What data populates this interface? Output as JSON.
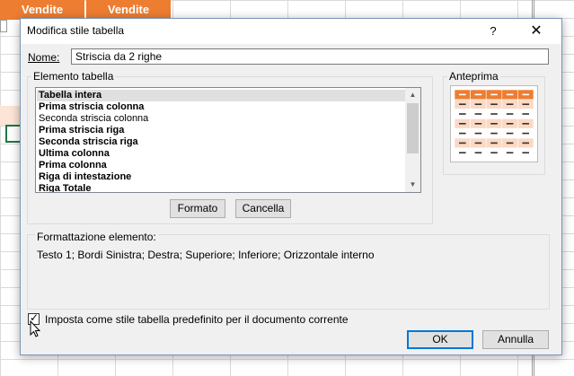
{
  "sheet": {
    "header_cells": [
      "Vendite",
      "Vendite"
    ],
    "accent_color": "#ed7d31"
  },
  "dialog": {
    "title": "Modifica stile tabella",
    "help_label": "?",
    "close_label": "✕",
    "name_label": "Nome:",
    "name_value": "Striscia da 2 righe",
    "element_group_label": "Elemento tabella",
    "elements": [
      {
        "label": "Tabella intera",
        "bold": true,
        "selected": true
      },
      {
        "label": "Prima striscia colonna",
        "bold": true,
        "selected": false
      },
      {
        "label": "Seconda striscia colonna",
        "bold": false,
        "selected": false
      },
      {
        "label": "Prima striscia riga",
        "bold": true,
        "selected": false
      },
      {
        "label": "Seconda striscia riga",
        "bold": true,
        "selected": false
      },
      {
        "label": "Ultima colonna",
        "bold": true,
        "selected": false
      },
      {
        "label": "Prima colonna",
        "bold": true,
        "selected": false
      },
      {
        "label": "Riga di intestazione",
        "bold": true,
        "selected": false
      },
      {
        "label": "Riga Totale",
        "bold": true,
        "selected": false
      }
    ],
    "format_button": "Formato",
    "clear_button": "Cancella",
    "preview_label": "Anteprima",
    "element_format_label": "Formattazione elemento:",
    "element_format_text": "Testo 1; Bordi Sinistra; Destra; Superiore; Inferiore; Orizzontale interno",
    "default_checkbox_label": "Imposta come stile tabella predefinito per il documento corrente",
    "default_checkbox_checked": true,
    "ok_button": "OK",
    "cancel_button": "Annulla"
  }
}
